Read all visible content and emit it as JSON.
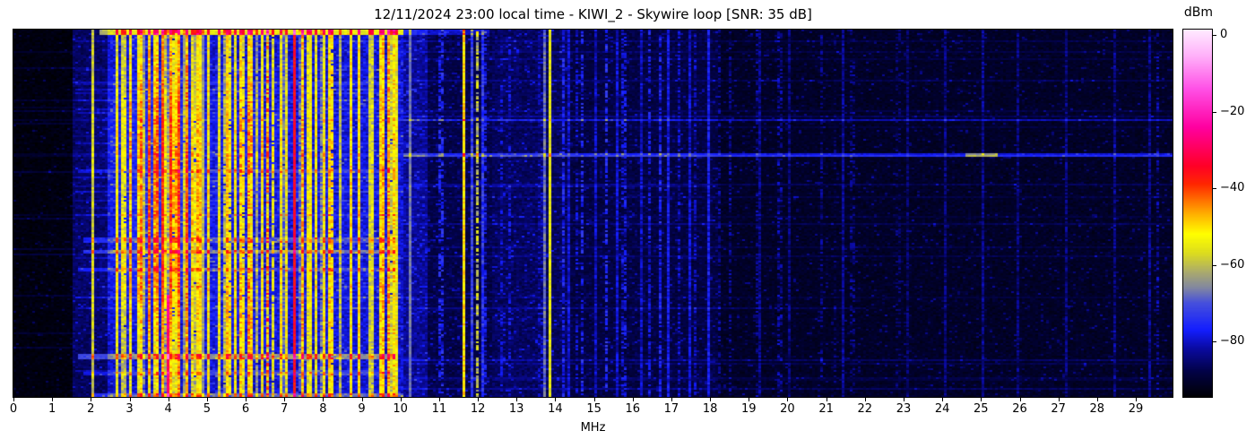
{
  "title": "12/11/2024 23:00 local time - KIWI_2 - Skywire loop [SNR: 35 dB]",
  "xlabel": "MHz",
  "colorbar": {
    "title": "dBm",
    "ticks": [
      {
        "value": 0,
        "label": "0"
      },
      {
        "value": -20,
        "label": "−20"
      },
      {
        "value": -40,
        "label": "−40"
      },
      {
        "value": -60,
        "label": "−60"
      },
      {
        "value": -80,
        "label": "−80"
      }
    ]
  },
  "x_axis": {
    "tick_labels": [
      "0",
      "1",
      "2",
      "3",
      "4",
      "5",
      "6",
      "7",
      "8",
      "9",
      "10",
      "11",
      "12",
      "13",
      "14",
      "15",
      "16",
      "17",
      "18",
      "19",
      "20",
      "21",
      "22",
      "23",
      "24",
      "25",
      "26",
      "27",
      "28",
      "29"
    ],
    "unit": "MHz"
  },
  "chart_data": {
    "type": "heatmap",
    "title": "12/11/2024 23:00 local time - KIWI_2 - Skywire loop [SNR: 35 dB]",
    "xlabel": "MHz",
    "colorbar_label": "dBm",
    "x_range_mhz": [
      0,
      29.95
    ],
    "value_range_dbm": [
      -94.5,
      1.5
    ],
    "colorbar_tick_values": [
      0,
      -20,
      -40,
      -60,
      -80
    ],
    "legend_position": "right-colorbar",
    "grid": false,
    "description": "HF waterfall spectrogram 0-30 MHz, time on vertical axis. Quiet black band below 1.5 MHz, dense yellow/orange/red broadcast and ham signals 2-10 MHz with strongest red carrier near 7.25 MHz, scattered signals 10-14 MHz, sparse faint blue carriers above 14 MHz, horizontal ionospheric event streaks.",
    "render": {
      "seed": 1337,
      "rows": 205,
      "cols": 431,
      "colormap_stops": [
        [
          -95,
          0,
          0,
          0
        ],
        [
          -88,
          2,
          2,
          70
        ],
        [
          -82,
          10,
          10,
          160
        ],
        [
          -77,
          20,
          30,
          255
        ],
        [
          -70,
          70,
          80,
          220
        ],
        [
          -66,
          130,
          135,
          160
        ],
        [
          -62,
          170,
          170,
          110
        ],
        [
          -57,
          220,
          220,
          30
        ],
        [
          -52,
          255,
          255,
          0
        ],
        [
          -47,
          255,
          180,
          0
        ],
        [
          -43,
          255,
          110,
          0
        ],
        [
          -39,
          255,
          40,
          0
        ],
        [
          -34,
          255,
          0,
          40
        ],
        [
          -24,
          255,
          0,
          160
        ],
        [
          -14,
          255,
          80,
          230
        ],
        [
          -5,
          255,
          180,
          250
        ],
        [
          1.5,
          255,
          235,
          255
        ]
      ],
      "regions": [
        [
          0,
          1.55,
          -93.5,
          1.4,
          0.05,
          7
        ],
        [
          1.55,
          2.4,
          -86.5,
          2.4,
          0.08,
          8
        ],
        [
          2.4,
          10.05,
          -80,
          3.4,
          0.12,
          10
        ],
        [
          10.05,
          10.7,
          -83,
          3.0,
          0.12,
          9
        ],
        [
          10.7,
          12.4,
          -88,
          2.4,
          0.1,
          9
        ],
        [
          12.4,
          14.4,
          -86.5,
          2.4,
          0.1,
          9
        ],
        [
          14.4,
          18.2,
          -88.5,
          2.2,
          0.08,
          8
        ],
        [
          18.2,
          29.96,
          -91,
          1.8,
          0.07,
          8
        ]
      ],
      "lines": [
        [
          2.02,
          0.05,
          -59,
          4,
          1,
          0,
          1
        ],
        [
          2.65,
          0.05,
          -57,
          5,
          1,
          0,
          1
        ],
        [
          2.83,
          0.05,
          -60,
          5,
          1,
          0,
          1
        ],
        [
          3.0,
          0.06,
          -54,
          5,
          1,
          0,
          1
        ],
        [
          3.21,
          0.05,
          -56,
          5,
          1,
          0,
          1
        ],
        [
          3.33,
          0.05,
          -52,
          6,
          1,
          0,
          1
        ],
        [
          3.48,
          0.06,
          -50,
          6,
          1,
          0,
          1
        ],
        [
          3.62,
          0.05,
          -55,
          6,
          1,
          0,
          1
        ],
        [
          3.74,
          0.05,
          -51,
          6,
          1,
          0,
          1
        ],
        [
          3.89,
          0.06,
          -48,
          5,
          1,
          0,
          1
        ],
        [
          4.0,
          0.045,
          -29,
          3,
          1,
          0.72,
          1
        ],
        [
          4.06,
          0.06,
          -49,
          5,
          1,
          0,
          1
        ],
        [
          4.26,
          0.07,
          -47,
          6,
          1,
          0,
          1
        ],
        [
          4.45,
          0.06,
          -48,
          6,
          1,
          0,
          1
        ],
        [
          4.62,
          0.05,
          -57,
          6,
          1,
          0,
          1
        ],
        [
          4.78,
          0.05,
          -53,
          6,
          1,
          0,
          1
        ],
        [
          4.92,
          0.04,
          -66,
          3,
          1,
          0,
          1
        ],
        [
          5.06,
          0.05,
          -55,
          6,
          1,
          0,
          1
        ],
        [
          5.3,
          0.05,
          -58,
          6,
          1,
          0,
          1
        ],
        [
          5.5,
          0.05,
          -53,
          6,
          1,
          0,
          1
        ],
        [
          5.73,
          0.05,
          -56,
          6,
          1,
          0,
          1
        ],
        [
          5.9,
          0.05,
          -52,
          6,
          1,
          0,
          1
        ],
        [
          6.07,
          0.05,
          -50,
          6,
          1,
          0,
          1
        ],
        [
          6.18,
          0.05,
          -53,
          6,
          1,
          0,
          1
        ],
        [
          6.42,
          0.05,
          -56,
          6,
          1,
          0,
          1
        ],
        [
          6.55,
          0.05,
          -46,
          8,
          0.55,
          0,
          1
        ],
        [
          6.9,
          0.05,
          -55,
          6,
          1,
          0,
          1
        ],
        [
          7.08,
          0.05,
          -57,
          6,
          1,
          0,
          1
        ],
        [
          7.26,
          0.12,
          -37,
          3,
          1,
          0,
          1
        ],
        [
          7.44,
          0.05,
          -49,
          6,
          1,
          0,
          1
        ],
        [
          7.62,
          0.05,
          -58,
          6,
          1,
          0,
          1
        ],
        [
          7.8,
          0.05,
          -56,
          6,
          1,
          0,
          1
        ],
        [
          8.0,
          0.05,
          -54,
          6,
          1,
          0,
          1
        ],
        [
          8.17,
          0.05,
          -52,
          6,
          1,
          0,
          1
        ],
        [
          8.45,
          0.04,
          -63,
          5,
          1,
          0,
          1
        ],
        [
          8.7,
          0.04,
          -60,
          5,
          1,
          0,
          1
        ],
        [
          8.95,
          0.05,
          -57,
          6,
          1,
          0,
          1
        ],
        [
          9.2,
          0.04,
          -61,
          5,
          1,
          0,
          1
        ],
        [
          9.46,
          0.05,
          -52,
          6,
          1,
          0,
          1
        ],
        [
          9.57,
          0.05,
          -49,
          6,
          1,
          0,
          1
        ],
        [
          9.68,
          0.06,
          -47,
          6,
          1,
          0,
          1
        ],
        [
          9.8,
          0.05,
          -51,
          6,
          1,
          0,
          1
        ],
        [
          9.92,
          0.05,
          -55,
          6,
          1,
          0,
          1
        ],
        [
          10.28,
          0.04,
          -67,
          2,
          1,
          0,
          1
        ],
        [
          11.62,
          0.07,
          -50,
          4,
          1,
          0,
          1
        ],
        [
          11.82,
          0.04,
          -73,
          5,
          1,
          0,
          1
        ],
        [
          11.97,
          0.04,
          -60,
          6,
          0.7,
          0,
          1
        ],
        [
          12.12,
          0.04,
          -74,
          5,
          1,
          0,
          1
        ],
        [
          13.7,
          0.04,
          -68,
          4,
          1,
          0,
          1
        ],
        [
          13.86,
          0.05,
          -55,
          3,
          1,
          0,
          1
        ],
        [
          14.35,
          0.04,
          -80,
          4,
          1,
          0,
          1
        ],
        [
          15.05,
          0.04,
          -81,
          4,
          1,
          0,
          1
        ],
        [
          15.6,
          0.04,
          -80,
          4,
          1,
          0,
          1
        ],
        [
          16.2,
          0.04,
          -81,
          4,
          1,
          0,
          1
        ],
        [
          16.9,
          0.04,
          -78,
          4,
          1,
          0,
          1
        ],
        [
          17.45,
          0.04,
          -80,
          4,
          1,
          0,
          1
        ],
        [
          17.95,
          0.04,
          -78,
          4,
          1,
          0,
          1
        ],
        [
          19.3,
          0.04,
          -84,
          4,
          1,
          0,
          1
        ],
        [
          20.05,
          0.04,
          -85,
          4,
          1,
          0,
          1
        ],
        [
          21.45,
          0.04,
          -84,
          4,
          1,
          0,
          1
        ],
        [
          23.1,
          0.04,
          -86,
          4,
          1,
          0,
          1
        ],
        [
          24.05,
          0.04,
          -85,
          4,
          1,
          0,
          1
        ],
        [
          25.05,
          0.04,
          -84,
          4,
          1,
          0,
          1
        ],
        [
          25.95,
          0.04,
          -85,
          4,
          1,
          0,
          1
        ],
        [
          27.2,
          0.04,
          -85,
          4,
          1,
          0,
          1
        ],
        [
          28.45,
          0.04,
          -86,
          4,
          1,
          0,
          1
        ],
        [
          29.35,
          0.04,
          -84,
          4,
          1,
          0,
          1
        ]
      ],
      "line_clusters": [
        {
          "f0": 2.45,
          "f1": 10.0,
          "count": 42,
          "lmin": -72,
          "lmax": -50,
          "duty": 0.9
        },
        {
          "f0": 10.55,
          "f1": 18.0,
          "count": 18,
          "lmin": -84,
          "lmax": -76,
          "duty": 0.55
        },
        {
          "f0": 18.0,
          "f1": 29.8,
          "count": 12,
          "lmin": -88,
          "lmax": -82,
          "duty": 0.45
        }
      ],
      "blobs": [
        [
          3.6,
          0.28,
          0.9,
          0.13,
          9
        ],
        [
          3.4,
          0.66,
          0.9,
          0.1,
          8
        ],
        [
          4.2,
          0.48,
          0.7,
          0.1,
          6
        ],
        [
          6.2,
          0.3,
          0.6,
          0.12,
          6
        ],
        [
          5.9,
          0.78,
          0.8,
          0.1,
          5
        ],
        [
          8.5,
          0.5,
          0.9,
          0.35,
          3
        ]
      ],
      "events": [
        [
          0.0,
          0.01,
          2.2,
          10.1,
          24
        ],
        [
          0.0,
          0.01,
          10.1,
          12.3,
          8
        ],
        [
          0.24,
          0.247,
          10.1,
          29.95,
          10
        ],
        [
          0.24,
          0.247,
          0.0,
          10.1,
          3
        ],
        [
          0.332,
          0.342,
          10.1,
          29.95,
          12
        ],
        [
          0.332,
          0.342,
          24.6,
          25.4,
          14
        ],
        [
          0.335,
          0.342,
          0.0,
          10.1,
          3
        ],
        [
          0.378,
          0.386,
          1.7,
          9.9,
          7
        ],
        [
          0.42,
          0.425,
          10.1,
          18.0,
          4
        ],
        [
          0.5,
          0.507,
          1.7,
          9.9,
          6
        ],
        [
          0.565,
          0.578,
          1.8,
          9.9,
          9
        ],
        [
          0.598,
          0.608,
          1.8,
          9.9,
          12
        ],
        [
          0.645,
          0.655,
          1.7,
          9.9,
          8
        ],
        [
          0.695,
          0.7,
          2.2,
          9.5,
          4
        ],
        [
          0.755,
          0.76,
          10.1,
          22.0,
          4
        ],
        [
          0.882,
          0.897,
          1.7,
          9.9,
          15
        ],
        [
          0.93,
          0.94,
          1.8,
          9.7,
          8
        ],
        [
          0.99,
          1.001,
          2.0,
          10.1,
          12
        ],
        [
          0.1,
          0.105,
          0.0,
          1.6,
          4
        ],
        [
          0.25,
          0.255,
          0.0,
          1.6,
          4
        ],
        [
          0.5,
          0.505,
          0.0,
          1.6,
          3
        ],
        [
          0.72,
          0.725,
          0.0,
          1.6,
          4
        ],
        [
          0.86,
          0.865,
          0.0,
          1.6,
          4
        ]
      ]
    }
  }
}
